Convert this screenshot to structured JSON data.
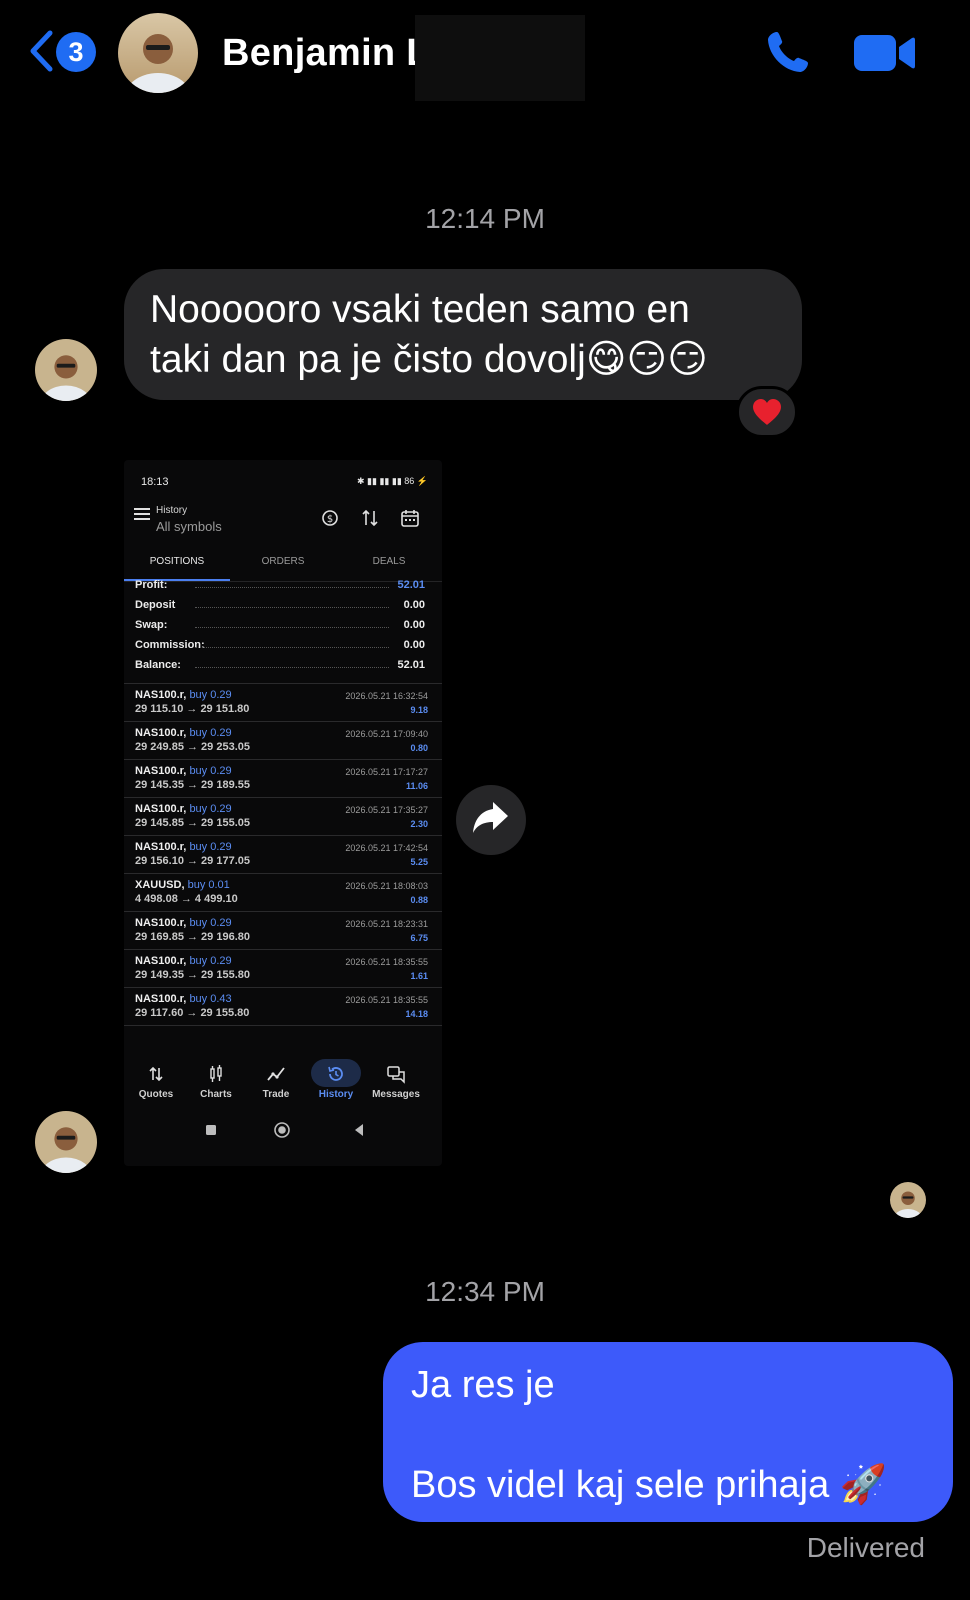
{
  "header": {
    "back_count": "3",
    "contact_name": "Benjamin L",
    "call_icon": "phone-icon",
    "video_icon": "video-camera-icon"
  },
  "conversation": {
    "time_1": "12:14 PM",
    "incoming_text_line1": "Noooooro vsaki teden samo en",
    "incoming_text_line2": "taki dan pa je čisto dovolj",
    "incoming_emojis": "😋😏😏",
    "reaction": "❤️",
    "time_2": "12:34 PM",
    "outgoing_line1": "Ja res je",
    "outgoing_line2": "Bos videl kaj sele prihaja 🚀",
    "delivery_status": "Delivered"
  },
  "attachment": {
    "status_time": "18:13",
    "status_right": "✱ ▮▮ ▮▮ ▮▮ 86 ⚡",
    "title": "History",
    "subtitle": "All symbols",
    "tabs": [
      "POSITIONS",
      "ORDERS",
      "DEALS"
    ],
    "summary": [
      {
        "label": "Profit:",
        "value": "52.01",
        "highlight": true
      },
      {
        "label": "Deposit",
        "value": "0.00",
        "highlight": false
      },
      {
        "label": "Swap:",
        "value": "0.00",
        "highlight": false
      },
      {
        "label": "Commission:",
        "value": "0.00",
        "highlight": false
      },
      {
        "label": "Balance:",
        "value": "52.01",
        "highlight": false
      }
    ],
    "trades": [
      {
        "symbol": "NAS100.r,",
        "side": "buy 0.29",
        "range": "29 115.10 → 29 151.80",
        "datetime": "2026.05.21 16:32:54",
        "profit": "9.18"
      },
      {
        "symbol": "NAS100.r,",
        "side": "buy 0.29",
        "range": "29 249.85 → 29 253.05",
        "datetime": "2026.05.21 17:09:40",
        "profit": "0.80"
      },
      {
        "symbol": "NAS100.r,",
        "side": "buy 0.29",
        "range": "29 145.35 → 29 189.55",
        "datetime": "2026.05.21 17:17:27",
        "profit": "11.06"
      },
      {
        "symbol": "NAS100.r,",
        "side": "buy 0.29",
        "range": "29 145.85 → 29 155.05",
        "datetime": "2026.05.21 17:35:27",
        "profit": "2.30"
      },
      {
        "symbol": "NAS100.r,",
        "side": "buy 0.29",
        "range": "29 156.10 → 29 177.05",
        "datetime": "2026.05.21 17:42:54",
        "profit": "5.25"
      },
      {
        "symbol": "XAUUSD,",
        "side": "buy 0.01",
        "range": "4 498.08 → 4 499.10",
        "datetime": "2026.05.21 18:08:03",
        "profit": "0.88"
      },
      {
        "symbol": "NAS100.r,",
        "side": "buy 0.29",
        "range": "29 169.85 → 29 196.80",
        "datetime": "2026.05.21 18:23:31",
        "profit": "6.75"
      },
      {
        "symbol": "NAS100.r,",
        "side": "buy 0.29",
        "range": "29 149.35 → 29 155.80",
        "datetime": "2026.05.21 18:35:55",
        "profit": "1.61"
      },
      {
        "symbol": "NAS100.r,",
        "side": "buy 0.43",
        "range": "29 117.60 → 29 155.80",
        "datetime": "2026.05.21 18:35:55",
        "profit": "14.18"
      }
    ],
    "nav": [
      {
        "label": "Quotes",
        "icon": "quotes-icon",
        "active": false
      },
      {
        "label": "Charts",
        "icon": "charts-icon",
        "active": false
      },
      {
        "label": "Trade",
        "icon": "trade-icon",
        "active": false
      },
      {
        "label": "History",
        "icon": "history-icon",
        "active": true
      },
      {
        "label": "Messages",
        "icon": "messages-icon",
        "active": false
      }
    ]
  },
  "colors": {
    "outgoing_bubble": "#3d5afa",
    "incoming_bubble": "#262628",
    "accent_blue": "#1f6cf3",
    "mt_blue": "#5b8df2"
  }
}
